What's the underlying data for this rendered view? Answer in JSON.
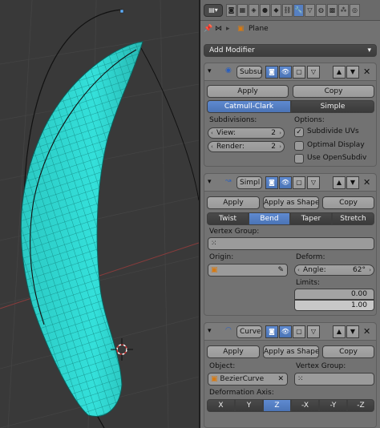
{
  "header": {
    "editor_icon": "properties-editor-icon",
    "context_icons": [
      "render-icon",
      "render-layers-icon",
      "scene-icon",
      "world-icon",
      "object-icon",
      "constraints-icon",
      "modifiers-icon",
      "data-icon",
      "material-icon",
      "texture-icon",
      "particles-icon",
      "physics-icon"
    ],
    "active_context": "modifiers-icon"
  },
  "breadcrumb": {
    "object_name": "Plane"
  },
  "add_modifier_label": "Add Modifier",
  "subsurf": {
    "name": "Subsu",
    "apply_label": "Apply",
    "copy_label": "Copy",
    "types": [
      "Catmull-Clark",
      "Simple"
    ],
    "selected_type": "Catmull-Clark",
    "subdivisions_label": "Subdivisions:",
    "view_label": "View:",
    "view_value": "2",
    "render_label": "Render:",
    "render_value": "2",
    "options_label": "Options:",
    "options": [
      {
        "label": "Subdivide UVs",
        "checked": true
      },
      {
        "label": "Optimal Display",
        "checked": false
      },
      {
        "label": "Use OpenSubdiv",
        "checked": false
      }
    ]
  },
  "simple_deform": {
    "name": "Simpl",
    "apply_label": "Apply",
    "apply_shape_label": "Apply as Shape ...",
    "copy_label": "Copy",
    "modes": [
      "Twist",
      "Bend",
      "Taper",
      "Stretch"
    ],
    "selected_mode": "Bend",
    "vertex_group_label": "Vertex Group:",
    "origin_label": "Origin:",
    "deform_label": "Deform:",
    "angle_label": "Angle:",
    "angle_value": "62°",
    "limits_label": "Limits:",
    "limit_min": "0.00",
    "limit_max": "1.00"
  },
  "curve": {
    "name": "Curve",
    "apply_label": "Apply",
    "apply_shape_label": "Apply as Shape ...",
    "copy_label": "Copy",
    "object_label": "Object:",
    "object_value": "BezierCurve",
    "vertex_group_label": "Vertex Group:",
    "axis_label": "Deformation Axis:",
    "axes": [
      "X",
      "Y",
      "Z",
      "-X",
      "-Y",
      "-Z"
    ],
    "selected_axis": "Z"
  },
  "colors": {
    "mesh": "#2fd6d0",
    "mesh_wire": "#0e7f7a",
    "selection": "#5680c2",
    "background": "#393939",
    "panel": "#727272"
  }
}
